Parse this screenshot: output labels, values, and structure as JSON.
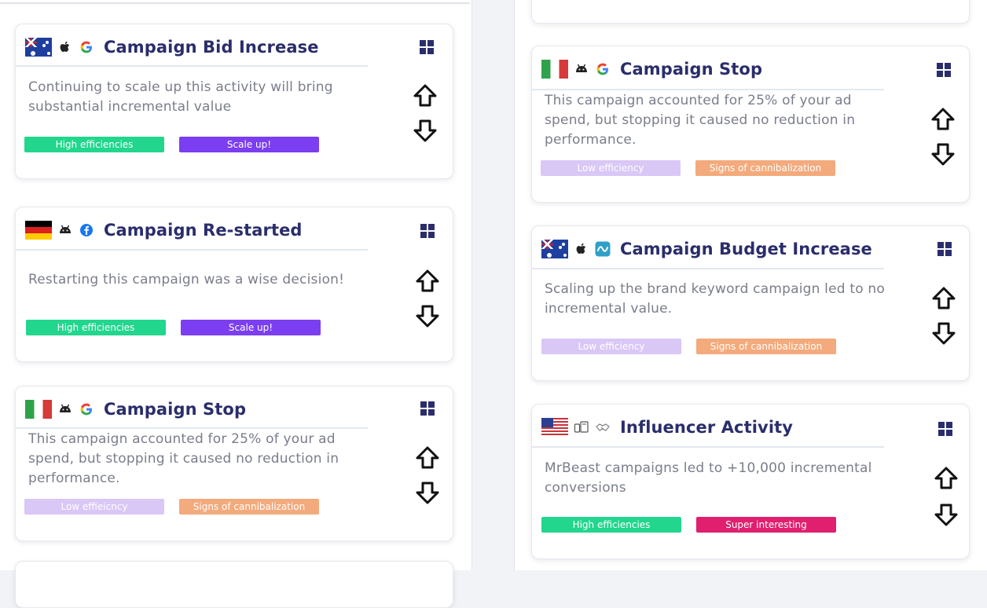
{
  "cards": [
    {
      "title": "Campaign Bid Increase",
      "flag": "australia-flag",
      "platform_icon": "apple-icon",
      "channel_icon": "google-icon",
      "description": [
        "Continuing to scale up this activity will bring",
        "substantial incremental value"
      ],
      "tags": [
        "High efficiencies",
        "Scale up!"
      ]
    },
    {
      "title": "Campaign Re-started",
      "flag": "germany-flag",
      "platform_icon": "android-icon",
      "channel_icon": "facebook-icon",
      "description": [
        "Restarting this campaign was a wise decision!"
      ],
      "tags": [
        "High efficiencies",
        "Scale up!"
      ]
    },
    {
      "title": "Campaign Stop",
      "flag": "italy-flag",
      "platform_icon": "android-icon",
      "channel_icon": "google-icon",
      "description": [
        "This campaign accounted for 25% of your ad",
        "spend, but stopping it caused no reduction in",
        "performance."
      ],
      "tags": [
        "Low effieicncy",
        "Signs of cannibalization"
      ]
    },
    {
      "title": "Campaign Stop",
      "flag": "italy-flag",
      "platform_icon": "android-icon",
      "channel_icon": "google-icon",
      "description": [
        "This campaign accounted for 25% of your ad",
        "spend, but stopping it caused no reduction in",
        "performance."
      ],
      "tags": [
        "Low efficiency",
        "Signs of cannibalization"
      ]
    },
    {
      "title": "Campaign Budget Increase",
      "flag": "australia-flag",
      "platform_icon": "apple-icon",
      "channel_icon": "analytics-app-icon",
      "description": [
        "Scaling up the brand keyword campaign led to no",
        "incremental value."
      ],
      "tags": [
        "Low efficiency",
        "Signs of cannibalization"
      ]
    },
    {
      "title": "Influencer Activity",
      "flag": "usa-flag",
      "platform_icon": "devices-icon",
      "channel_icon": "handshake-icon",
      "description": [
        "MrBeast campaigns led to +10,000 incremental",
        "conversions"
      ],
      "tags": [
        "High efficiencies",
        "Super interesting"
      ]
    }
  ],
  "colors": {
    "title": "#2a2d6b",
    "tag_high_efficiencies": "#22d68d",
    "tag_scale_up": "#7b3ef0",
    "tag_low_efficiency": "#d9c7f6",
    "tag_cannibalization": "#f3aa7c",
    "tag_super_interesting": "#e0206f"
  }
}
